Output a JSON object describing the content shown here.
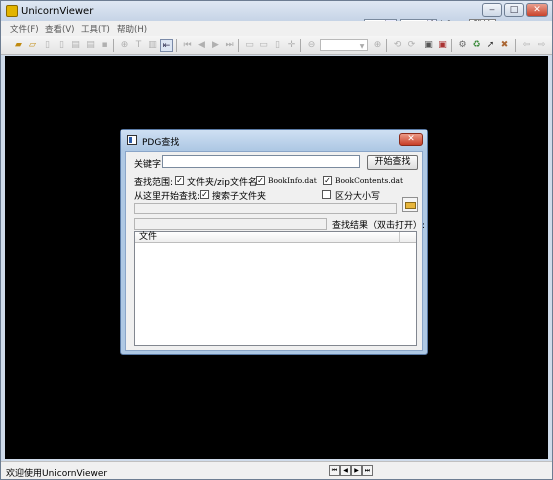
{
  "window": {
    "title": "UnicornViewer",
    "controls": {
      "minimize": "‒",
      "maximize": "□",
      "close": "✕"
    }
  },
  "menu": [
    "文件(F)",
    "查看(V)",
    "工具(T)",
    "帮助(H)"
  ],
  "page_nav": {
    "current_page": "0",
    "separator": "/",
    "total_pages": "0",
    "jump_label": "跳转"
  },
  "toolbar": {
    "icons": [
      "open-folder-icon",
      "open-file-icon",
      "page-icon",
      "page2-icon",
      "print-icon",
      "print-setup-icon",
      "save-icon",
      "zoom-icon",
      "text-select-icon",
      "fit-page-icon",
      "fit-width-icon",
      "first-page-icon",
      "prev-page-icon",
      "next-page-icon",
      "last-page-icon",
      "single-page-icon",
      "double-page-icon",
      "continuous-icon",
      "move-icon",
      "zoom-out-icon",
      "zoom-in-icon",
      "rotate-left-icon",
      "rotate-right-icon",
      "screenshot-icon",
      "book-icon",
      "settings-icon",
      "recycle-icon",
      "cursor-icon",
      "tools-icon",
      "back-icon",
      "forward-icon"
    ]
  },
  "statusbar": {
    "text": "欢迎使用UnicornViewer",
    "nav": [
      "⏮",
      "◀",
      "▶",
      "⏭"
    ]
  },
  "dialog": {
    "title": "PDG查找",
    "close": "✕",
    "keyword_label": "关键字:",
    "keyword_value": "",
    "start_button": "开始查找",
    "scope_label": "查找范围:",
    "scope_options": [
      {
        "label": "文件夹/zip文件名",
        "checked": true
      },
      {
        "label": "BookInfo.dat",
        "checked": true
      },
      {
        "label": "BookContents.dat",
        "checked": true
      }
    ],
    "start_from_label": "从这里开始查找:",
    "subfolders": {
      "label": "搜索子文件夹",
      "checked": true
    },
    "case_sensitive": {
      "label": "区分大小写",
      "checked": false
    },
    "path_value": "",
    "results_label": "查找结果（双击打开）:",
    "results_columns": [
      "文件"
    ]
  }
}
